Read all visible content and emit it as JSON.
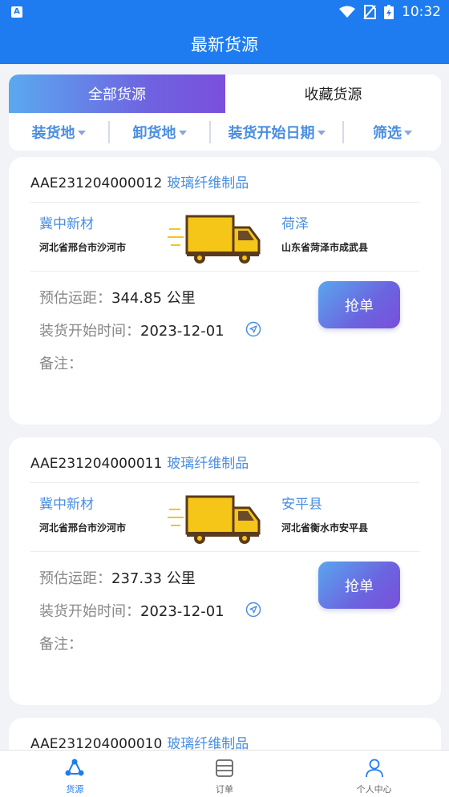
{
  "status_bar": {
    "time": "10:32",
    "badge": "A"
  },
  "header": {
    "title": "最新货源"
  },
  "tabs": [
    {
      "label": "全部货源",
      "active": true
    },
    {
      "label": "收藏货源",
      "active": false
    }
  ],
  "filters": [
    {
      "label": "装货地"
    },
    {
      "label": "卸货地"
    },
    {
      "label": "装货开始日期"
    },
    {
      "label": "筛选"
    }
  ],
  "labels": {
    "distance": "预估运距：",
    "start_time": "装货开始时间：",
    "note": "备注：",
    "grab": "抢单"
  },
  "orders": [
    {
      "code": "AAE231204000012",
      "category": "玻璃纤维制品",
      "from_name": "冀中新材",
      "from_addr": "河北省邢台市沙河市",
      "to_name": "荷泽",
      "to_addr": "山东省菏泽市成武县",
      "distance": "344.85 公里",
      "start_date": "2023-12-01",
      "note": ""
    },
    {
      "code": "AAE231204000011",
      "category": "玻璃纤维制品",
      "from_name": "冀中新材",
      "from_addr": "河北省邢台市沙河市",
      "to_name": "安平县",
      "to_addr": "河北省衡水市安平县",
      "distance": "237.33 公里",
      "start_date": "2023-12-01",
      "note": ""
    },
    {
      "code": "AAE231204000010",
      "category": "玻璃纤维制品"
    }
  ],
  "bottom_nav": [
    {
      "label": "货源",
      "active": true,
      "icon": "cargo-icon"
    },
    {
      "label": "订单",
      "active": false,
      "icon": "order-icon"
    },
    {
      "label": "个人中心",
      "active": false,
      "icon": "user-icon"
    }
  ],
  "colors": {
    "primary": "#1e7cf0",
    "accent_blue": "#4a8ee0",
    "gradient_end": "#7a4fdc"
  }
}
